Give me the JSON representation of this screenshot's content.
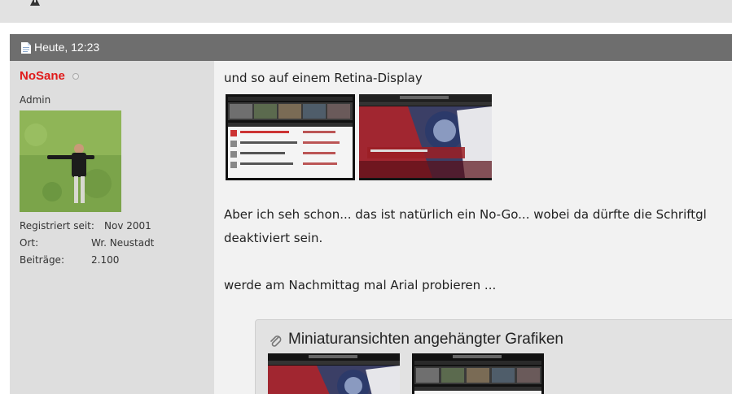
{
  "post": {
    "date": "Heute, 12:23",
    "username": "NoSane",
    "usertitle": "Admin",
    "stats": [
      {
        "label": "Registriert seit:",
        "value": "Nov 2001"
      },
      {
        "label": "Ort:",
        "value": "Wr. Neustadt"
      },
      {
        "label": "Beiträge:",
        "value": "2.100"
      }
    ],
    "paragraphs": [
      "und so auf einem Retina-Display",
      "Aber ich seh schon... das ist natürlich ein No-Go... wobei da dürfte die Schriftgl",
      "deaktiviert sein.",
      "werde am Nachmittag mal Arial probieren ..."
    ],
    "attachments_title": "Miniaturansichten angehängter Grafiken"
  },
  "icons": {
    "warning": "warning-icon",
    "document": "document-icon",
    "paperclip": "paperclip-icon",
    "status": "offline-status-icon"
  },
  "colors": {
    "username": "#e01a1a",
    "header_bg": "#6e6e6e",
    "sidebar_bg": "#dedede",
    "post_bg": "#f2f2f2"
  }
}
